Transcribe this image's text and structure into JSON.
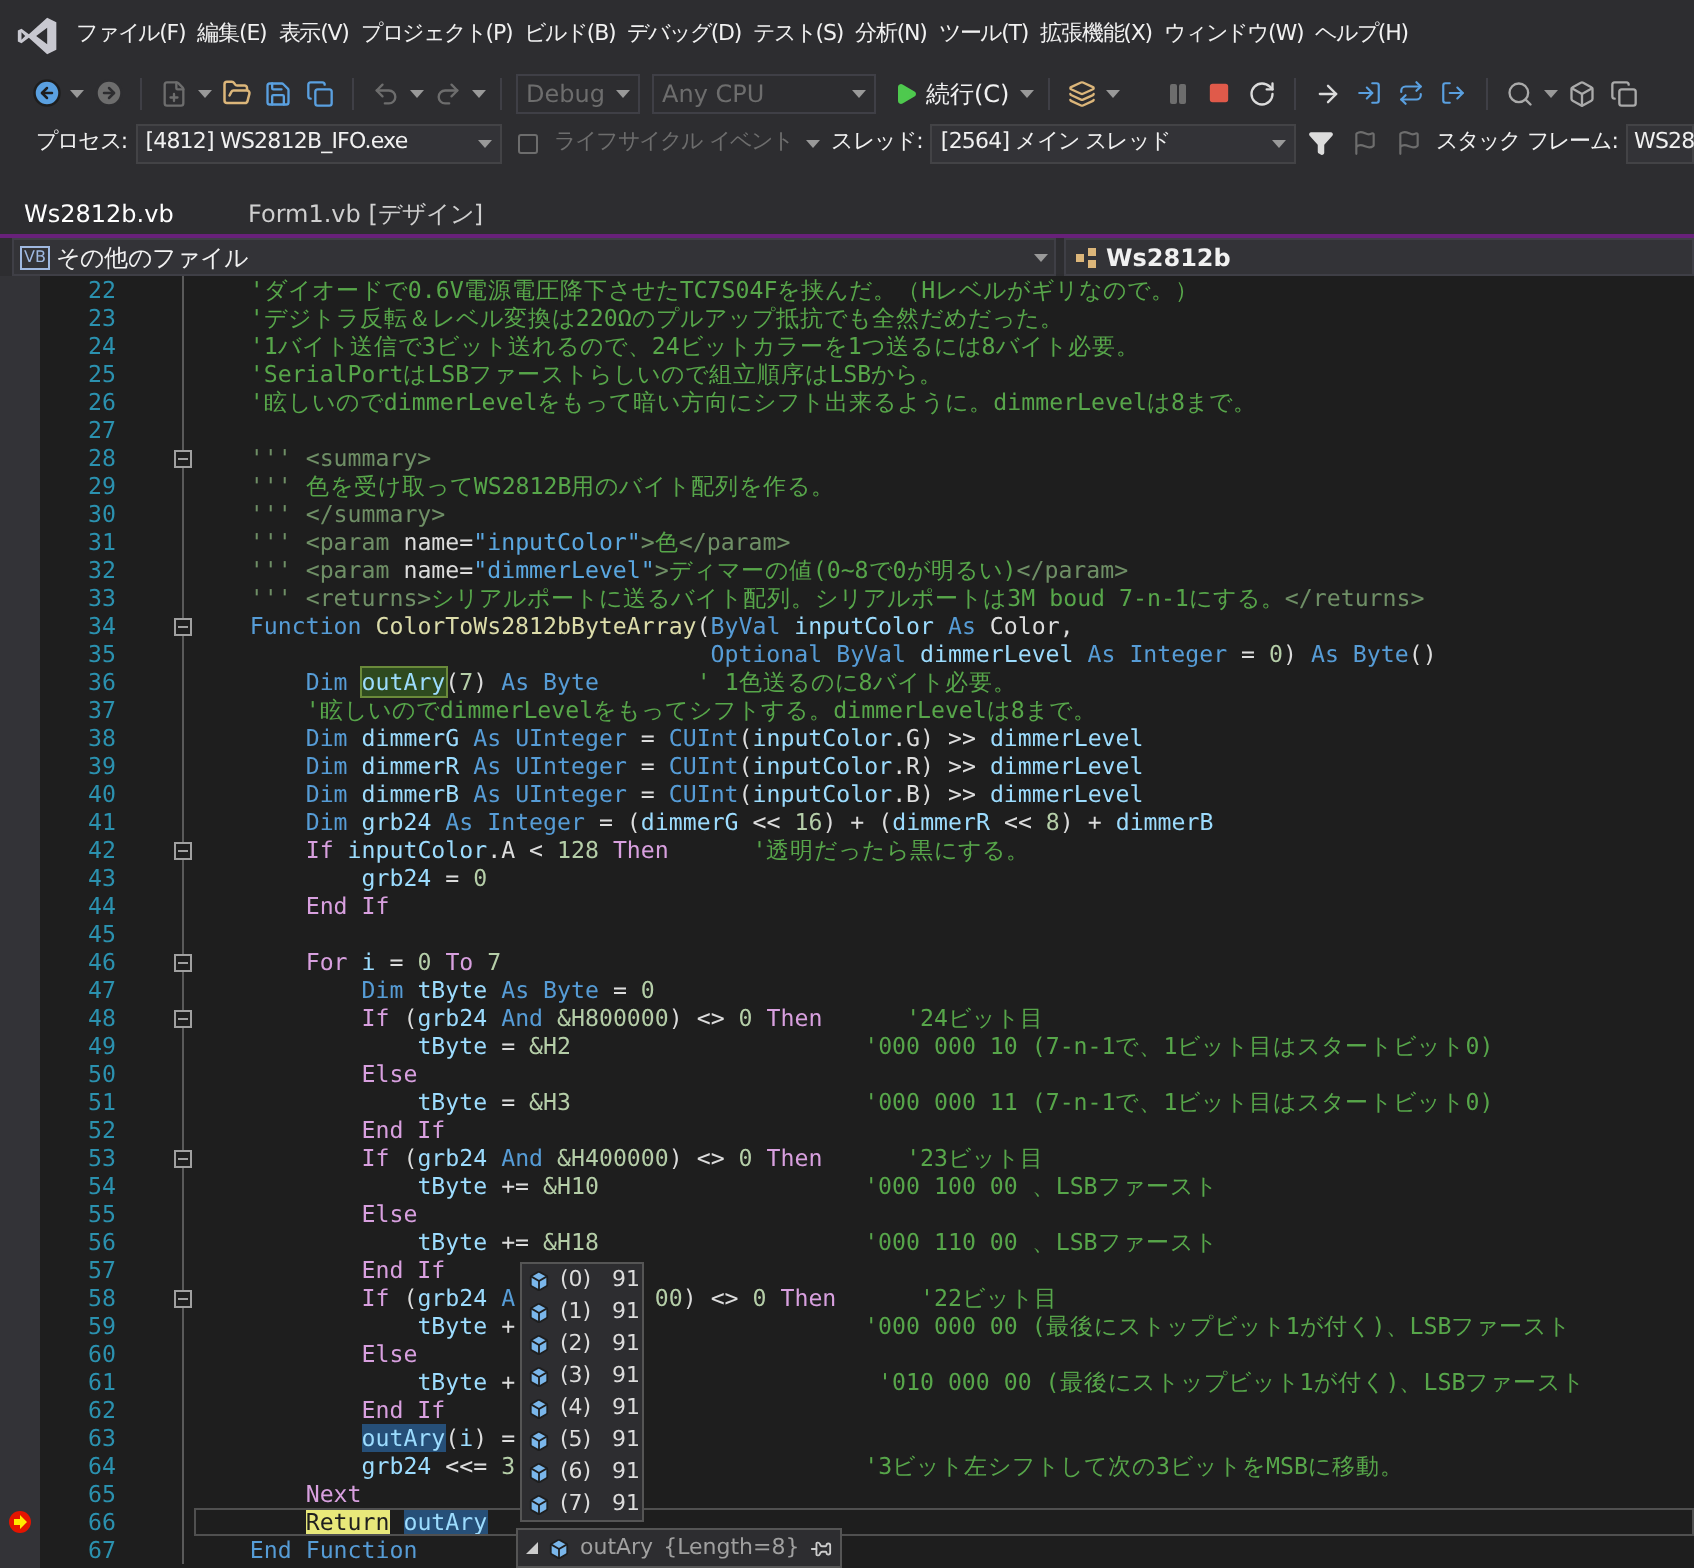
{
  "menu": [
    "ファイル(F)",
    "編集(E)",
    "表示(V)",
    "プロジェクト(P)",
    "ビルド(B)",
    "デバッグ(D)",
    "テスト(S)",
    "分析(N)",
    "ツール(T)",
    "拡張機能(X)",
    "ウィンドウ(W)",
    "ヘルプ(H)"
  ],
  "toolbar": {
    "configuration": {
      "value": "Debug",
      "disabled": true
    },
    "platform": {
      "value": "Any CPU",
      "disabled": true
    },
    "continue": "続行(C)"
  },
  "debug_location": {
    "process_label": "プロセス:",
    "process": "[4812] WS2812B_IFO.exe",
    "lifecycle": {
      "label": "ライフサイクル イベント",
      "disabled": true
    },
    "thread_label": "スレッド:",
    "thread": "[2564] メイン スレッド",
    "stack_label": "スタック フレーム:",
    "stack": "WS28"
  },
  "tabs": [
    {
      "label": "Ws2812b.vb",
      "selected": true
    },
    {
      "label": "Form1.vb [デザイン]",
      "selected": false
    }
  ],
  "nav": {
    "project_badge": "VB",
    "project": "その他のファイル",
    "type": "Ws2812b"
  },
  "editor": {
    "lines": [
      {
        "number": "22",
        "fold": false,
        "current": false,
        "segments": [
          {
            "text": "    'ダイオードで0.6V電源電圧降下させたTC7S04Fを挟んだ。（Hレベルがギリなので。）",
            "kind": "c"
          }
        ]
      },
      {
        "number": "23",
        "fold": false,
        "current": false,
        "segments": [
          {
            "text": "    'デジトラ反転＆レベル変換は220Ωのプルアップ抵抗でも全然だめだった。",
            "kind": "c"
          }
        ]
      },
      {
        "number": "24",
        "fold": false,
        "current": false,
        "segments": [
          {
            "text": "    '1バイト送信で3ビット送れるので、24ビットカラーを1つ送るには8バイト必要。",
            "kind": "c"
          }
        ]
      },
      {
        "number": "25",
        "fold": false,
        "current": false,
        "segments": [
          {
            "text": "    'SerialPortはLSBファーストらしいので組立順序はLSBから。",
            "kind": "c"
          }
        ]
      },
      {
        "number": "26",
        "fold": false,
        "current": false,
        "segments": [
          {
            "text": "    '眩しいのでdimmerLevelをもって暗い方向にシフト出来るように。dimmerLevelは8まで。",
            "kind": "c"
          }
        ]
      },
      {
        "number": "27",
        "fold": false,
        "current": false
      },
      {
        "number": "28",
        "fold": true,
        "current": false,
        "segments": [
          {
            "text": "    ''' <summary>",
            "kind": "d"
          }
        ]
      },
      {
        "number": "29",
        "fold": false,
        "current": false,
        "segments": [
          {
            "text": "    '''",
            "kind": "d"
          },
          {
            "text": " 色を受け取ってWS2812B用のバイト配列を作る。",
            "kind": "c"
          }
        ]
      },
      {
        "number": "30",
        "fold": false,
        "current": false,
        "segments": [
          {
            "text": "    ''' </summary>",
            "kind": "d"
          }
        ]
      },
      {
        "number": "31",
        "fold": false,
        "current": false,
        "segments": [
          {
            "text": "    ''' <param",
            "kind": "d"
          },
          {
            "text": " name=",
            "kind": "t"
          },
          {
            "text": "\"inputColor\"",
            "kind": "a"
          },
          {
            "text": ">",
            "kind": "d"
          },
          {
            "text": "色",
            "kind": "c"
          },
          {
            "text": "</param>",
            "kind": "d"
          }
        ]
      },
      {
        "number": "32",
        "fold": false,
        "current": false,
        "segments": [
          {
            "text": "    ''' <param",
            "kind": "d"
          },
          {
            "text": " name=",
            "kind": "t"
          },
          {
            "text": "\"dimmerLevel\"",
            "kind": "a"
          },
          {
            "text": ">",
            "kind": "d"
          },
          {
            "text": "ディマーの値(0~8で0が明るい)",
            "kind": "c"
          },
          {
            "text": "</param>",
            "kind": "d"
          }
        ]
      },
      {
        "number": "33",
        "fold": false,
        "current": false,
        "segments": [
          {
            "text": "    ''' <returns>",
            "kind": "d"
          },
          {
            "text": "シリアルポートに送るバイト配列。シリアルポートは3M boud 7-n-1にする。",
            "kind": "c"
          },
          {
            "text": "</returns>",
            "kind": "d"
          }
        ]
      },
      {
        "number": "34",
        "fold": true,
        "current": false,
        "segments": [
          {
            "text": "    Function ",
            "kind": "k"
          },
          {
            "text": "ColorToWs2812bByteArray",
            "kind": "m"
          },
          {
            "text": "(",
            "kind": "t"
          },
          {
            "text": "ByVal ",
            "kind": "k"
          },
          {
            "text": "inputColor ",
            "kind": "v"
          },
          {
            "text": "As ",
            "kind": "k"
          },
          {
            "text": "Color,",
            "kind": "t"
          }
        ]
      },
      {
        "number": "35",
        "fold": false,
        "current": false,
        "segments": [
          {
            "text": "                                     Optional ByVal ",
            "kind": "k"
          },
          {
            "text": "dimmerLevel ",
            "kind": "v"
          },
          {
            "text": "As Integer ",
            "kind": "k"
          },
          {
            "text": "= ",
            "kind": "t"
          },
          {
            "text": "0",
            "kind": "n"
          },
          {
            "text": ") ",
            "kind": "t"
          },
          {
            "text": "As Byte",
            "kind": "k"
          },
          {
            "text": "()",
            "kind": "t"
          }
        ]
      },
      {
        "number": "36",
        "fold": false,
        "current": false,
        "segments": [
          {
            "text": "        Dim ",
            "kind": "k"
          },
          {
            "text": "outAry",
            "kind": "v",
            "reference_highlight": true
          },
          {
            "text": "(",
            "kind": "t"
          },
          {
            "text": "7",
            "kind": "n"
          },
          {
            "text": ") ",
            "kind": "t"
          },
          {
            "text": "As Byte",
            "kind": "k"
          },
          {
            "text": "       ' 1色送るのに8バイト必要。",
            "kind": "c"
          }
        ]
      },
      {
        "number": "37",
        "fold": false,
        "current": false,
        "segments": [
          {
            "text": "        '眩しいのでdimmerLevelをもってシフトする。dimmerLevelは8まで。",
            "kind": "c"
          }
        ]
      },
      {
        "number": "38",
        "fold": false,
        "current": false,
        "segments": [
          {
            "text": "        Dim ",
            "kind": "k"
          },
          {
            "text": "dimmerG ",
            "kind": "v"
          },
          {
            "text": "As UInteger ",
            "kind": "k"
          },
          {
            "text": "= ",
            "kind": "t"
          },
          {
            "text": "CUInt",
            "kind": "k"
          },
          {
            "text": "(",
            "kind": "t"
          },
          {
            "text": "inputColor",
            "kind": "v"
          },
          {
            "text": ".G) >> ",
            "kind": "t"
          },
          {
            "text": "dimmerLevel",
            "kind": "v"
          }
        ]
      },
      {
        "number": "39",
        "fold": false,
        "current": false,
        "segments": [
          {
            "text": "        Dim ",
            "kind": "k"
          },
          {
            "text": "dimmerR ",
            "kind": "v"
          },
          {
            "text": "As UInteger ",
            "kind": "k"
          },
          {
            "text": "= ",
            "kind": "t"
          },
          {
            "text": "CUInt",
            "kind": "k"
          },
          {
            "text": "(",
            "kind": "t"
          },
          {
            "text": "inputColor",
            "kind": "v"
          },
          {
            "text": ".R) >> ",
            "kind": "t"
          },
          {
            "text": "dimmerLevel",
            "kind": "v"
          }
        ]
      },
      {
        "number": "40",
        "fold": false,
        "current": false,
        "segments": [
          {
            "text": "        Dim ",
            "kind": "k"
          },
          {
            "text": "dimmerB ",
            "kind": "v"
          },
          {
            "text": "As UInteger ",
            "kind": "k"
          },
          {
            "text": "= ",
            "kind": "t"
          },
          {
            "text": "CUInt",
            "kind": "k"
          },
          {
            "text": "(",
            "kind": "t"
          },
          {
            "text": "inputColor",
            "kind": "v"
          },
          {
            "text": ".B) >> ",
            "kind": "t"
          },
          {
            "text": "dimmerLevel",
            "kind": "v"
          }
        ]
      },
      {
        "number": "41",
        "fold": false,
        "current": false,
        "segments": [
          {
            "text": "        Dim ",
            "kind": "k"
          },
          {
            "text": "grb24 ",
            "kind": "v"
          },
          {
            "text": "As Integer ",
            "kind": "k"
          },
          {
            "text": "= (",
            "kind": "t"
          },
          {
            "text": "dimmerG",
            "kind": "v"
          },
          {
            "text": " << ",
            "kind": "t"
          },
          {
            "text": "16",
            "kind": "n"
          },
          {
            "text": ") + (",
            "kind": "t"
          },
          {
            "text": "dimmerR",
            "kind": "v"
          },
          {
            "text": " << ",
            "kind": "t"
          },
          {
            "text": "8",
            "kind": "n"
          },
          {
            "text": ") + ",
            "kind": "t"
          },
          {
            "text": "dimmerB",
            "kind": "v"
          }
        ]
      },
      {
        "number": "42",
        "fold": true,
        "current": false,
        "segments": [
          {
            "text": "        If ",
            "kind": "f"
          },
          {
            "text": "inputColor",
            "kind": "v"
          },
          {
            "text": ".A < ",
            "kind": "t"
          },
          {
            "text": "128 ",
            "kind": "n"
          },
          {
            "text": "Then",
            "kind": "f"
          },
          {
            "text": "      '透明だったら黒にする。",
            "kind": "c"
          }
        ]
      },
      {
        "number": "43",
        "fold": false,
        "current": false,
        "segments": [
          {
            "text": "            grb24",
            "kind": "v"
          },
          {
            "text": " = ",
            "kind": "t"
          },
          {
            "text": "0",
            "kind": "n"
          }
        ]
      },
      {
        "number": "44",
        "fold": false,
        "current": false,
        "segments": [
          {
            "text": "        End If",
            "kind": "f"
          }
        ]
      },
      {
        "number": "45",
        "fold": false,
        "current": false
      },
      {
        "number": "46",
        "fold": true,
        "current": false,
        "segments": [
          {
            "text": "        For ",
            "kind": "f"
          },
          {
            "text": "i",
            "kind": "v"
          },
          {
            "text": " = ",
            "kind": "t"
          },
          {
            "text": "0 ",
            "kind": "n"
          },
          {
            "text": "To ",
            "kind": "f"
          },
          {
            "text": "7",
            "kind": "n"
          }
        ]
      },
      {
        "number": "47",
        "fold": false,
        "current": false,
        "segments": [
          {
            "text": "            Dim ",
            "kind": "k"
          },
          {
            "text": "tByte ",
            "kind": "v"
          },
          {
            "text": "As Byte ",
            "kind": "k"
          },
          {
            "text": "= ",
            "kind": "t"
          },
          {
            "text": "0",
            "kind": "n"
          }
        ]
      },
      {
        "number": "48",
        "fold": true,
        "current": false,
        "segments": [
          {
            "text": "            If ",
            "kind": "f"
          },
          {
            "text": "(",
            "kind": "t"
          },
          {
            "text": "grb24 ",
            "kind": "v"
          },
          {
            "text": "And ",
            "kind": "k"
          },
          {
            "text": "&H800000",
            "kind": "n"
          },
          {
            "text": ") <> ",
            "kind": "t"
          },
          {
            "text": "0 ",
            "kind": "n"
          },
          {
            "text": "Then",
            "kind": "f"
          },
          {
            "text": "      '24ビット目",
            "kind": "c"
          }
        ]
      },
      {
        "number": "49",
        "fold": false,
        "current": false,
        "segments": [
          {
            "text": "                tByte",
            "kind": "v"
          },
          {
            "text": " = ",
            "kind": "t"
          },
          {
            "text": "&H2",
            "kind": "n"
          },
          {
            "text": "                     '000 000 10 (7-n-1で、1ビット目はスタートビット0)",
            "kind": "c"
          }
        ]
      },
      {
        "number": "50",
        "fold": false,
        "current": false,
        "segments": [
          {
            "text": "            Else",
            "kind": "f"
          }
        ]
      },
      {
        "number": "51",
        "fold": false,
        "current": false,
        "segments": [
          {
            "text": "                tByte",
            "kind": "v"
          },
          {
            "text": " = ",
            "kind": "t"
          },
          {
            "text": "&H3",
            "kind": "n"
          },
          {
            "text": "                     '000 000 11 (7-n-1で、1ビット目はスタートビット0)",
            "kind": "c"
          }
        ]
      },
      {
        "number": "52",
        "fold": false,
        "current": false,
        "segments": [
          {
            "text": "            End If",
            "kind": "f"
          }
        ]
      },
      {
        "number": "53",
        "fold": true,
        "current": false,
        "segments": [
          {
            "text": "            If ",
            "kind": "f"
          },
          {
            "text": "(",
            "kind": "t"
          },
          {
            "text": "grb24 ",
            "kind": "v"
          },
          {
            "text": "And ",
            "kind": "k"
          },
          {
            "text": "&H400000",
            "kind": "n"
          },
          {
            "text": ") <> ",
            "kind": "t"
          },
          {
            "text": "0 ",
            "kind": "n"
          },
          {
            "text": "Then",
            "kind": "f"
          },
          {
            "text": "      '23ビット目",
            "kind": "c"
          }
        ]
      },
      {
        "number": "54",
        "fold": false,
        "current": false,
        "segments": [
          {
            "text": "                tByte",
            "kind": "v"
          },
          {
            "text": " += ",
            "kind": "t"
          },
          {
            "text": "&H10",
            "kind": "n"
          },
          {
            "text": "                   '000 100 00 、LSBファースト",
            "kind": "c"
          }
        ]
      },
      {
        "number": "55",
        "fold": false,
        "current": false,
        "segments": [
          {
            "text": "            Else",
            "kind": "f"
          }
        ]
      },
      {
        "number": "56",
        "fold": false,
        "current": false,
        "segments": [
          {
            "text": "                tByte",
            "kind": "v"
          },
          {
            "text": " += ",
            "kind": "t"
          },
          {
            "text": "&H18",
            "kind": "n"
          },
          {
            "text": "                   '000 110 00 、LSBファースト",
            "kind": "c"
          }
        ]
      },
      {
        "number": "57",
        "fold": false,
        "current": false,
        "segments": [
          {
            "text": "            End If",
            "kind": "f"
          }
        ]
      },
      {
        "number": "58",
        "fold": true,
        "current": false,
        "segments": [
          {
            "text": "            If ",
            "kind": "f"
          },
          {
            "text": "(",
            "kind": "t"
          },
          {
            "text": "grb24 ",
            "kind": "v"
          },
          {
            "text": "A",
            "kind": "k"
          },
          {
            "text": "          00",
            "kind": "n"
          },
          {
            "text": ") <> ",
            "kind": "t"
          },
          {
            "text": "0 ",
            "kind": "n"
          },
          {
            "text": "Then",
            "kind": "f"
          },
          {
            "text": "      '22ビット目",
            "kind": "c"
          }
        ]
      },
      {
        "number": "59",
        "fold": false,
        "current": false,
        "segments": [
          {
            "text": "                tByte",
            "kind": "v"
          },
          {
            "text": " +",
            "kind": "t"
          },
          {
            "text": "                         '000 000 00 (最後にストップビット1が付く)、LSBファースト",
            "kind": "c"
          }
        ]
      },
      {
        "number": "60",
        "fold": false,
        "current": false,
        "segments": [
          {
            "text": "            Else",
            "kind": "f"
          }
        ]
      },
      {
        "number": "61",
        "fold": false,
        "current": false,
        "segments": [
          {
            "text": "                tByte",
            "kind": "v"
          },
          {
            "text": " +",
            "kind": "t"
          },
          {
            "text": "                          '010 000 00 (最後にストップビット1が付く)、LSBファースト",
            "kind": "c"
          }
        ]
      },
      {
        "number": "62",
        "fold": false,
        "current": false,
        "segments": [
          {
            "text": "            End If",
            "kind": "f"
          }
        ]
      },
      {
        "number": "63",
        "fold": false,
        "current": false,
        "segments": [
          {
            "text": "            outAry",
            "kind": "v",
            "selected": true
          },
          {
            "text": "(",
            "kind": "t"
          },
          {
            "text": "i",
            "kind": "v"
          },
          {
            "text": ") =",
            "kind": "t"
          }
        ]
      },
      {
        "number": "64",
        "fold": false,
        "current": false,
        "segments": [
          {
            "text": "            grb24",
            "kind": "v"
          },
          {
            "text": " <<= ",
            "kind": "t"
          },
          {
            "text": "3",
            "kind": "n"
          },
          {
            "text": "                         '3ビット左シフトして次の3ビットをMSBに移動。",
            "kind": "c"
          }
        ]
      },
      {
        "number": "65",
        "fold": false,
        "current": false,
        "segments": [
          {
            "text": "        Next",
            "kind": "f"
          }
        ]
      },
      {
        "number": "66",
        "fold": false,
        "current": true,
        "segments": [
          {
            "text": "        Return",
            "kind": "f",
            "current_statement": true
          },
          {
            "text": " outAry",
            "kind": "v",
            "selected": true
          }
        ]
      },
      {
        "number": "67",
        "fold": false,
        "current": false,
        "segments": [
          {
            "text": "    End Function",
            "kind": "k"
          }
        ]
      }
    ]
  },
  "datatip": {
    "name": "outAry",
    "value": "{Length=8}",
    "items": [
      {
        "index": "(0)",
        "value": "91"
      },
      {
        "index": "(1)",
        "value": "91"
      },
      {
        "index": "(2)",
        "value": "91"
      },
      {
        "index": "(3)",
        "value": "91"
      },
      {
        "index": "(4)",
        "value": "91"
      },
      {
        "index": "(5)",
        "value": "91"
      },
      {
        "index": "(6)",
        "value": "91"
      },
      {
        "index": "(7)",
        "value": "91"
      }
    ]
  }
}
